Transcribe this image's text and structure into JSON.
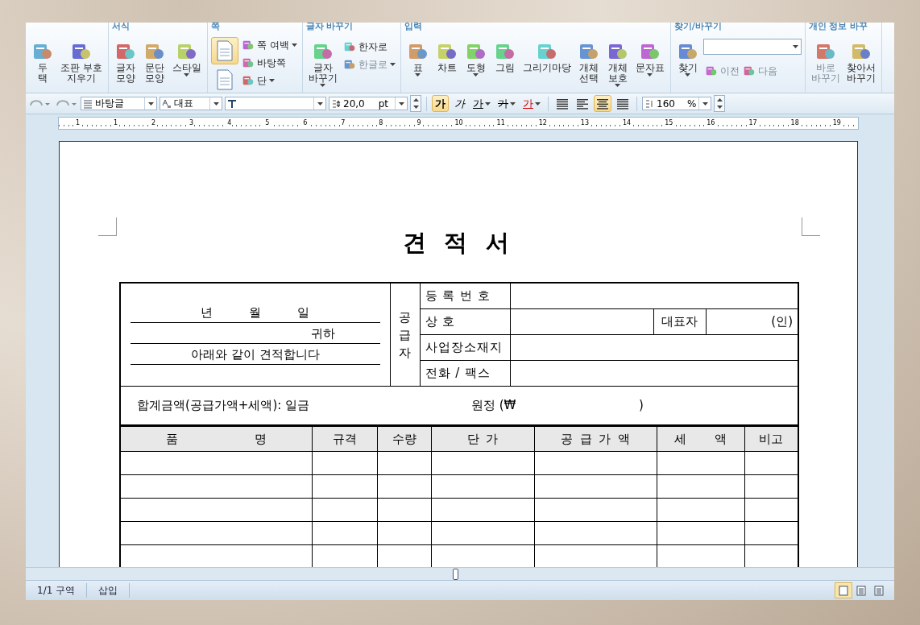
{
  "ribbon": {
    "groups": [
      {
        "items": [
          {
            "label": "두\n택",
            "kind": "large",
            "disabled": false,
            "dropdown": false
          },
          {
            "label": "조판 부호\n지우기",
            "kind": "large",
            "disabled": false,
            "dropdown": false
          }
        ]
      },
      {
        "title": "서식",
        "items": [
          {
            "label": "글자\n모양",
            "kind": "large",
            "disabled": false,
            "dropdown": false
          },
          {
            "label": "문단\n모양",
            "kind": "large",
            "disabled": false,
            "dropdown": false
          },
          {
            "label": "스타일",
            "kind": "large",
            "disabled": false,
            "dropdown": true
          }
        ]
      },
      {
        "title": "쪽",
        "items": [
          {
            "kind": "page",
            "selected": true
          },
          {
            "kind": "page",
            "selected": false
          },
          {
            "label": "쪽 여백",
            "kind": "small",
            "disabled": false,
            "dropdown": true
          },
          {
            "label": "바탕쪽",
            "kind": "small",
            "disabled": false,
            "dropdown": false
          },
          {
            "label": "단",
            "kind": "small",
            "disabled": false,
            "dropdown": true
          }
        ]
      },
      {
        "title": "글자 바꾸기",
        "items": [
          {
            "label": "글자\n바꾸기",
            "kind": "large",
            "disabled": false,
            "dropdown": true
          },
          {
            "label": "한자로",
            "kind": "small",
            "disabled": false,
            "dropdown": false
          },
          {
            "label": "한글로",
            "kind": "small",
            "disabled": true,
            "dropdown": true
          }
        ]
      },
      {
        "title": "입력",
        "items": [
          {
            "label": "표",
            "kind": "large",
            "disabled": false,
            "dropdown": true
          },
          {
            "label": "차트",
            "kind": "large",
            "disabled": false,
            "dropdown": false
          },
          {
            "label": "도형",
            "kind": "large",
            "disabled": false,
            "dropdown": true
          },
          {
            "label": "그림",
            "kind": "large",
            "disabled": false,
            "dropdown": false
          },
          {
            "label": "그리기마당",
            "kind": "large",
            "disabled": false,
            "dropdown": false
          },
          {
            "label": "개체\n선택",
            "kind": "large",
            "disabled": false,
            "dropdown": false
          },
          {
            "label": "개체\n보호",
            "kind": "large",
            "disabled": false,
            "dropdown": true
          },
          {
            "label": "문자표",
            "kind": "large",
            "disabled": false,
            "dropdown": true
          }
        ]
      },
      {
        "title": "찾기/바꾸기",
        "items": [
          {
            "label": "찾기",
            "kind": "large",
            "disabled": false,
            "dropdown": true
          },
          {
            "kind": "combo"
          },
          {
            "label": "이전",
            "kind": "nav",
            "disabled": true
          },
          {
            "label": "다음",
            "kind": "nav",
            "disabled": true
          }
        ]
      },
      {
        "title": "개인 정보 바꾸",
        "items": [
          {
            "label": "바로\n바꾸기",
            "kind": "large",
            "disabled": true,
            "dropdown": false
          },
          {
            "label": "찾아서\n바꾸기",
            "kind": "large",
            "disabled": false,
            "dropdown": false
          }
        ]
      }
    ]
  },
  "format_bar": {
    "style": "바탕글",
    "language": "대표",
    "size": "20,0",
    "size_unit": "pt",
    "char_buttons": [
      {
        "label": "가",
        "kind": "bold",
        "selected": true,
        "dropdown": false
      },
      {
        "label": "가",
        "kind": "italic",
        "selected": false,
        "dropdown": false
      },
      {
        "label": "가",
        "kind": "underline",
        "selected": false,
        "dropdown": true
      },
      {
        "label": "가",
        "kind": "strike",
        "selected": false,
        "dropdown": true
      },
      {
        "label": "가",
        "kind": "color",
        "selected": false,
        "dropdown": true
      }
    ],
    "align": [
      {
        "selected": false
      },
      {
        "selected": false
      },
      {
        "selected": true
      },
      {
        "selected": false
      }
    ],
    "line_spacing": "160",
    "line_spacing_unit": "%"
  },
  "ruler": {
    "labels": [
      "1",
      "1",
      "2",
      "3",
      "4",
      "5",
      "6",
      "7",
      "8",
      "9",
      "10",
      "11",
      "12",
      "13",
      "14",
      "15",
      "16",
      "17",
      "18",
      "19"
    ]
  },
  "document": {
    "title": "견 적 서",
    "recipient": {
      "date": "년 월 일",
      "honorific": "귀하",
      "statement": "아래와 같이 견적합니다"
    },
    "supplier_label": "공\n급\n자",
    "supplier_rows": [
      {
        "label": "등 록 번 호"
      },
      {
        "label": "상 호",
        "extra_label": "대표자",
        "extra_value": "(인)"
      },
      {
        "label": "사업장소재지"
      },
      {
        "label": "전화 / 팩스"
      }
    ],
    "total": {
      "label": "합계금액(공급가액+세액): 일금",
      "suffix": "원정 (₩",
      "close": ")"
    },
    "columns": [
      "품 명",
      "규격",
      "수량",
      "단 가",
      "공 급 가 액",
      "세 액",
      "비고"
    ]
  },
  "status_bar": {
    "section": "1/1 구역",
    "mode": "삽입",
    "views": [
      {
        "selected": true
      },
      {
        "selected": false
      },
      {
        "selected": false
      }
    ]
  }
}
